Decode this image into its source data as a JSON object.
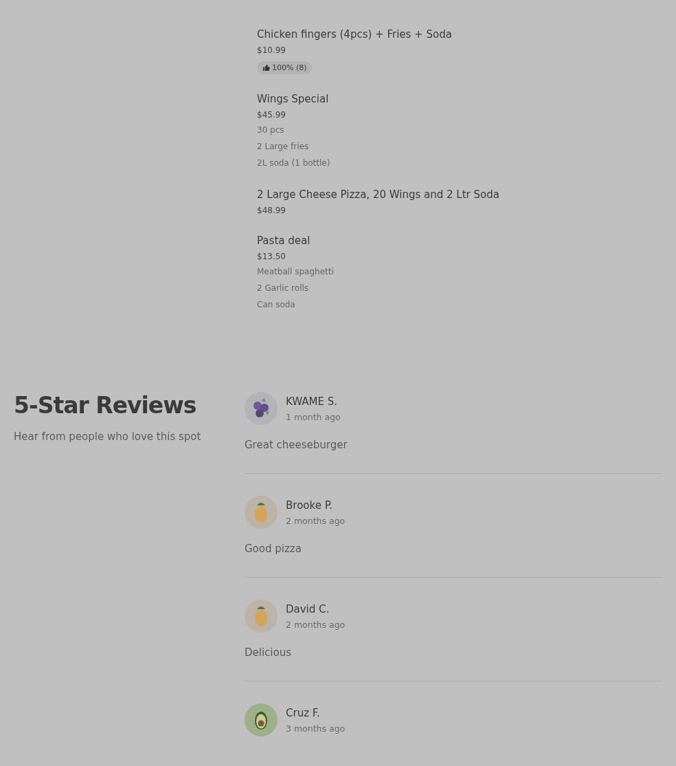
{
  "menu_items": [
    {
      "name": "Chicken fingers (4pcs) + Fries + Soda",
      "price": "$10.99",
      "rating": "100% (8)"
    },
    {
      "name": "Wings Special",
      "price": "$45.99",
      "description": [
        "30 pcs",
        "2 Large fries",
        "2L soda (1 bottle)"
      ]
    },
    {
      "name": "2 Large Cheese Pizza, 20 Wings and 2 Ltr Soda",
      "price": "$48.99"
    },
    {
      "name": "Pasta deal",
      "price": "$13.50",
      "description": [
        "Meatball spaghetti",
        "2 Garlic rolls",
        "Can soda"
      ]
    }
  ],
  "reviews_section": {
    "title": "5-Star Reviews",
    "subtitle": "Hear from people who love this spot",
    "reviews": [
      {
        "author": "KWAME S.",
        "time": "1 month ago",
        "text": "Great cheeseburger",
        "avatar": {
          "kind": "blueberry"
        }
      },
      {
        "author": "Brooke P.",
        "time": "2 months ago",
        "text": "Good pizza",
        "avatar": {
          "kind": "pineapple"
        }
      },
      {
        "author": "David C.",
        "time": "2 months ago",
        "text": "Delicious",
        "avatar": {
          "kind": "pineapple"
        }
      },
      {
        "author": "Cruz F.",
        "time": "3 months ago",
        "avatar": {
          "kind": "avocado"
        }
      }
    ]
  }
}
